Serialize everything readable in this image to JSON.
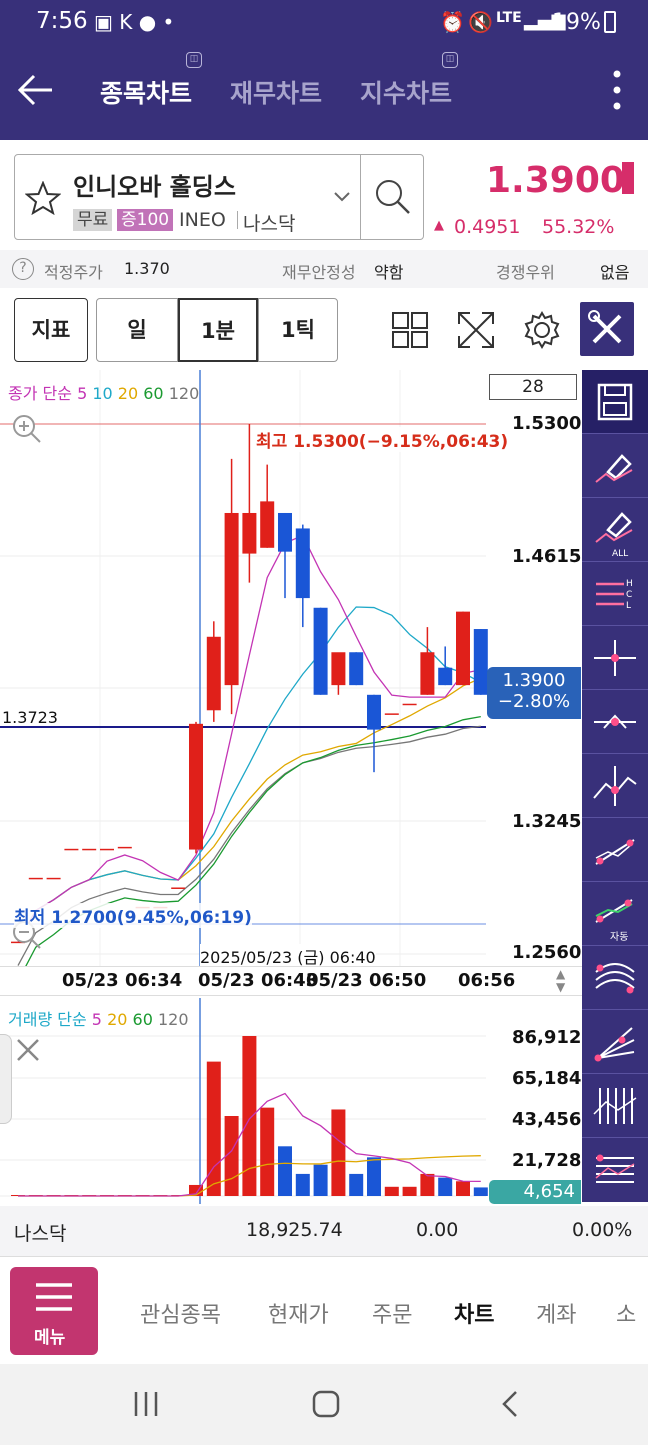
{
  "status_bar": {
    "time": "7:56",
    "battery": "19%",
    "network": "LTE"
  },
  "app_bar": {
    "tabs": [
      {
        "label": "종목차트",
        "active": true
      },
      {
        "label": "재무차트",
        "active": false
      },
      {
        "label": "지수차트",
        "active": false
      }
    ]
  },
  "stock": {
    "name": "인니오바 홀딩스",
    "tags": [
      "무료",
      "증100"
    ],
    "ticker": "INEO",
    "market": "나스닥",
    "price": "1.3900",
    "change": "0.4951",
    "change_pct": "55.32%"
  },
  "info_row": {
    "fair_label": "적정주가",
    "fair_value": "1.370",
    "stability_label": "재무안정성",
    "stability_value": "약함",
    "comp_label": "경쟁우위",
    "comp_value": "없음"
  },
  "toolbar": {
    "indicator": "지표",
    "periods": [
      "일",
      "1분",
      "1틱"
    ],
    "selected_period": "1분"
  },
  "price_chart": {
    "legend_title": "종가 단순",
    "ma_periods": [
      "5",
      "10",
      "20",
      "60",
      "120"
    ],
    "count_box": "28",
    "high_label": "최고 1.5300(−9.15%,06:43)",
    "low_label": "최저 1.2700(9.45%,06:19)",
    "crosshair_price": "1.3723",
    "crosshair_time": "2025/05/23 (금) 06:40",
    "current_price": "1.3900",
    "current_pct": "−2.80%",
    "y_ticks": [
      "1.5300",
      "1.4615",
      "1.3245",
      "1.2560"
    ],
    "x_labels": [
      "05/23 06:34",
      "05/23 06:43",
      "05/23 06:50",
      "06:56"
    ]
  },
  "volume_chart": {
    "legend_title": "거래량 단순",
    "ma_periods": [
      "5",
      "20",
      "60",
      "120"
    ],
    "y_ticks": [
      "86,912",
      "65,184",
      "43,456",
      "21,728"
    ],
    "current": "4,654"
  },
  "chart_data": {
    "type": "candlestick",
    "candles": [
      {
        "o": 1.262,
        "h": 1.262,
        "c": 1.262,
        "l": 1.262
      },
      {
        "o": 1.295,
        "h": 1.295,
        "c": 1.295,
        "l": 1.295
      },
      {
        "o": 1.295,
        "h": 1.295,
        "c": 1.295,
        "l": 1.295
      },
      {
        "o": 1.31,
        "h": 1.31,
        "c": 1.31,
        "l": 1.31
      },
      {
        "o": 1.31,
        "h": 1.31,
        "c": 1.31,
        "l": 1.31
      },
      {
        "o": 1.31,
        "h": 1.31,
        "c": 1.31,
        "l": 1.31
      },
      {
        "o": 1.311,
        "h": 1.311,
        "c": 1.311,
        "l": 1.311
      },
      {
        "o": 1.28,
        "h": 1.28,
        "c": 1.28,
        "l": 1.28
      },
      {
        "o": 1.28,
        "h": 1.28,
        "c": 1.28,
        "l": 1.28
      },
      {
        "o": 1.29,
        "h": 1.29,
        "c": 1.29,
        "l": 1.29
      },
      {
        "o": 1.31,
        "h": 1.376,
        "c": 1.375,
        "l": 1.308
      },
      {
        "o": 1.382,
        "h": 1.428,
        "c": 1.42,
        "l": 1.376
      },
      {
        "o": 1.395,
        "h": 1.512,
        "c": 1.484,
        "l": 1.38
      },
      {
        "o": 1.463,
        "h": 1.53,
        "c": 1.484,
        "l": 1.448
      },
      {
        "o": 1.466,
        "h": 1.509,
        "c": 1.49,
        "l": 1.466
      },
      {
        "o": 1.484,
        "h": 1.484,
        "c": 1.464,
        "l": 1.44
      },
      {
        "o": 1.476,
        "h": 1.478,
        "c": 1.44,
        "l": 1.425
      },
      {
        "o": 1.435,
        "h": 1.435,
        "c": 1.39,
        "l": 1.39
      },
      {
        "o": 1.395,
        "h": 1.41,
        "c": 1.412,
        "l": 1.39
      },
      {
        "o": 1.412,
        "h": 1.412,
        "c": 1.395,
        "l": 1.395
      },
      {
        "o": 1.39,
        "h": 1.39,
        "c": 1.372,
        "l": 1.35
      },
      {
        "o": 1.38,
        "h": 1.38,
        "c": 1.38,
        "l": 1.38
      },
      {
        "o": 1.385,
        "h": 1.385,
        "c": 1.385,
        "l": 1.385
      },
      {
        "o": 1.39,
        "h": 1.425,
        "c": 1.412,
        "l": 1.39
      },
      {
        "o": 1.404,
        "h": 1.415,
        "c": 1.395,
        "l": 1.395
      },
      {
        "o": 1.395,
        "h": 1.433,
        "c": 1.433,
        "l": 1.395
      },
      {
        "o": 1.424,
        "h": 1.424,
        "c": 1.39,
        "l": 1.39
      }
    ],
    "volumes": [
      0,
      0,
      0,
      0,
      0,
      0,
      0,
      0,
      0,
      0,
      6000,
      73000,
      43456,
      86912,
      48000,
      27000,
      12000,
      17000,
      47000,
      12000,
      21000,
      5000,
      5000,
      12000,
      10000,
      8000,
      4654
    ],
    "ylim": [
      1.256,
      1.53
    ]
  }
}
